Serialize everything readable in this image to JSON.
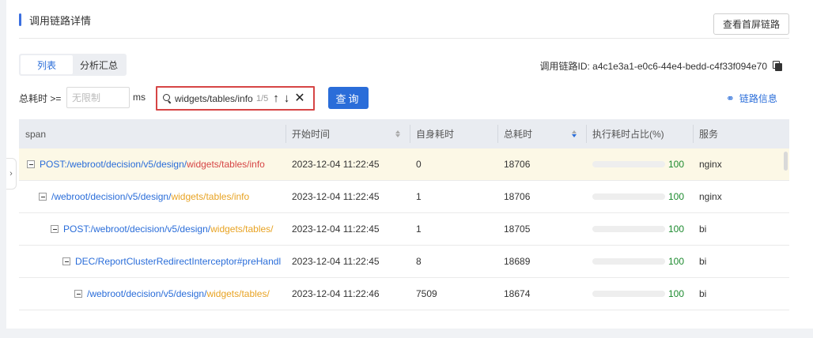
{
  "header": {
    "title": "调用链路详情",
    "first_screen_button": "查看首屏链路"
  },
  "tabs": [
    {
      "label": "列表",
      "active": true
    },
    {
      "label": "分析汇总",
      "active": false
    }
  ],
  "trace": {
    "label": "调用链路ID: a4c1e3a1-e0c6-44e4-bedd-c4f33f094e70"
  },
  "filter": {
    "label": "总耗时 >=",
    "placeholder": "无限制",
    "unit": "ms",
    "search_value": "widgets/tables/info",
    "match_count": "1/5",
    "prev_icon": "↑",
    "next_icon": "↓",
    "close_icon": "✕",
    "query_label": "查询"
  },
  "trace_info": {
    "label": "链路信息"
  },
  "table": {
    "columns": [
      "span",
      "开始时间",
      "自身耗时",
      "总耗时",
      "执行耗时占比(%)",
      "服务"
    ],
    "rows": [
      {
        "prefix": "POST:/webroot/decision/v5/design/",
        "highlight": "widgets/tables/info",
        "suffix": "",
        "start": "2023-12-04 11:22:45",
        "self": "0",
        "total": "18706",
        "ratio": 100,
        "ratio_label": "100",
        "service": "nginx"
      },
      {
        "prefix": "/webroot/decision/v5/design/",
        "highlight": "widgets/tables/info",
        "suffix": "",
        "start": "2023-12-04 11:22:45",
        "self": "1",
        "total": "18706",
        "ratio": 100,
        "ratio_label": "100",
        "service": "nginx"
      },
      {
        "prefix": "POST:/webroot/decision/v5/design/",
        "highlight": "widgets/tables/",
        "suffix": "",
        "start": "2023-12-04 11:22:45",
        "self": "1",
        "total": "18705",
        "ratio": 100,
        "ratio_label": "100",
        "service": "bi"
      },
      {
        "prefix": "DEC/ReportClusterRedirectInterceptor#preHandl",
        "highlight": "",
        "suffix": "",
        "start": "2023-12-04 11:22:45",
        "self": "8",
        "total": "18689",
        "ratio": 100,
        "ratio_label": "100",
        "service": "bi"
      },
      {
        "prefix": "/webroot/decision/v5/design/",
        "highlight": "widgets/tables/",
        "suffix": "",
        "start": "2023-12-04 11:22:46",
        "self": "7509",
        "total": "18674",
        "ratio": 100,
        "ratio_label": "100",
        "service": "bi"
      }
    ]
  }
}
